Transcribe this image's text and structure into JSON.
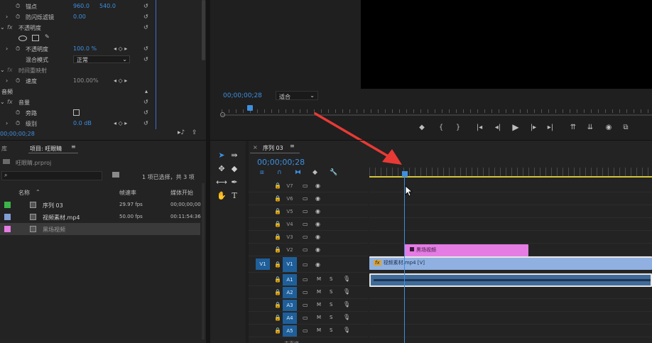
{
  "effect_controls": {
    "anchor_label": "锚点",
    "anchor_x": "960.0",
    "anchor_y": "540.0",
    "antiflicker_label": "防闪烁滤镜",
    "antiflicker_value": "0.00",
    "opacity_section": "不透明度",
    "opacity_label": "不透明度",
    "opacity_value": "100.0 %",
    "blend_label": "混合模式",
    "blend_value": "正常",
    "time_remap": "时间重映射",
    "speed_label": "速度",
    "speed_value": "100.00%",
    "audio_header": "音频",
    "volume_label": "音量",
    "bypass_label": "旁路",
    "level_label": "级别",
    "level_value": "0.0 dB",
    "timecode": "00;00;00;28",
    "fx": "fx"
  },
  "program_monitor": {
    "timecode": "00;00;00;28",
    "fit_label": "适合",
    "buttons": [
      "marker-icon",
      "in-point-icon",
      "out-point-icon",
      "go-to-in-icon",
      "step-back-icon",
      "play-icon",
      "step-forward-icon",
      "go-to-out-icon",
      "lift-icon",
      "extract-icon",
      "export-frame-icon",
      "comparison-icon"
    ]
  },
  "project": {
    "tab_library": "库",
    "tab_project": "项目: 旺眼睛",
    "file_name": "旺眼睛.prproj",
    "selection_info": "1 项已选择，共 3 项",
    "columns": {
      "name": "名称",
      "fps": "帧速率",
      "start": "媒体开始"
    },
    "items": [
      {
        "name": "序列 03",
        "fps": "29.97 fps",
        "start": "00;00;00;00",
        "color": "#3bb54a",
        "selected": false
      },
      {
        "name": "视频素材.mp4",
        "fps": "50.00 fps",
        "start": "00:11:54:36",
        "color": "#7f9fd6",
        "selected": false
      },
      {
        "name": "黑场视频",
        "fps": "",
        "start": "",
        "color": "#e47ce4",
        "selected": true
      }
    ]
  },
  "timeline": {
    "tab_title": "序列 03",
    "timecode": "00;00;00;28",
    "tracks_video": [
      "V7",
      "V6",
      "V5",
      "V4",
      "V3",
      "V2",
      "V1"
    ],
    "tracks_audio": [
      "A1",
      "A2",
      "A3",
      "A4",
      "A5"
    ],
    "source_v": "V1",
    "mute": "M",
    "solo": "S",
    "master_label": "主声道",
    "clip_black": "黑场视频",
    "clip_video": "视频素材.mp4 [V]",
    "clip_fx": "fx"
  },
  "colors": {
    "accent_blue": "#3d8fe0",
    "clip_pink": "#e47ce4",
    "clip_blue": "#8fb0e0",
    "arrow_red": "#e83a35",
    "track_target_blue": "#1f5f99"
  }
}
